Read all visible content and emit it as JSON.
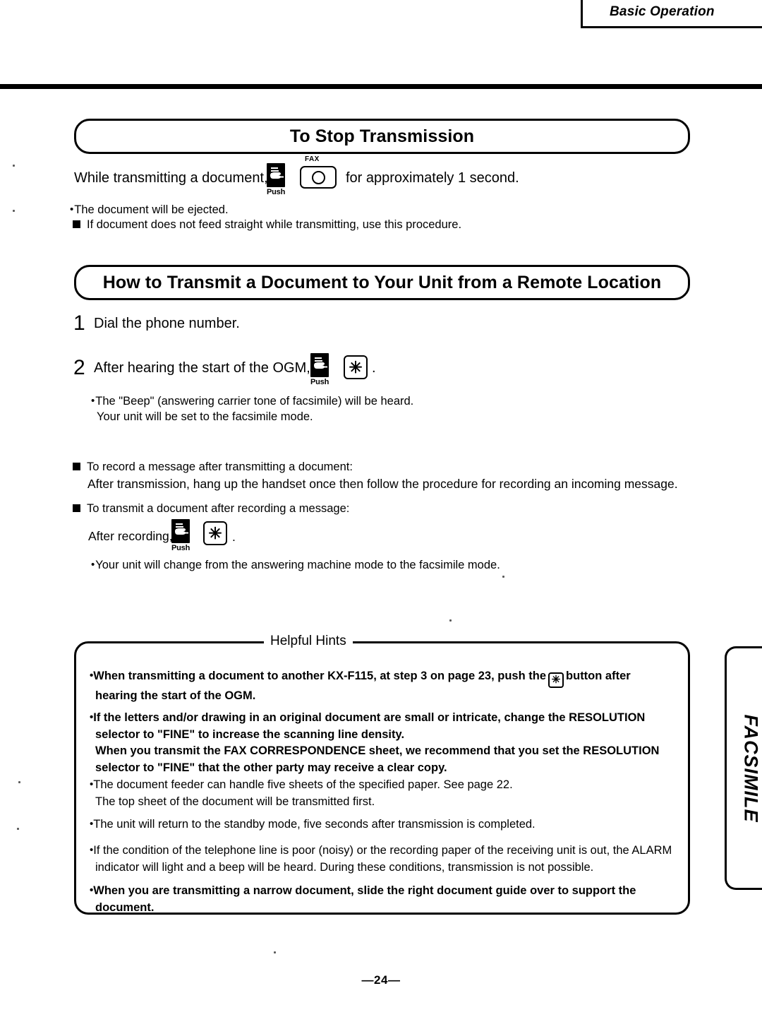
{
  "header": {
    "running_head": "Basic Operation"
  },
  "sections": [
    {
      "title": "To Stop Transmission",
      "instruction_before": "While transmitting a document,",
      "instruction_after": "for approximately 1 second.",
      "push_label": "Push",
      "fax_button_caption": "FAX",
      "notes": [
        "The document will be ejected."
      ],
      "square_notes": [
        "If document does not feed straight while transmitting, use this procedure."
      ]
    },
    {
      "title": "How to Transmit a Document to Your Unit from a Remote Location",
      "steps": [
        {
          "number": "1",
          "text": "Dial the phone number."
        },
        {
          "number": "2",
          "text_before": "After hearing the start of the OGM,",
          "text_after": ".",
          "push_label": "Push",
          "star_key": "✳",
          "notes": [
            "The \"Beep\" (answering carrier tone of facsimile) will be heard.",
            "Your unit will be set to the facsimile mode."
          ]
        }
      ],
      "square_notes": [
        {
          "heading": "To record a message after transmitting a document:",
          "body": "After transmission, hang up the handset once then follow the procedure for recording an incoming message."
        },
        {
          "heading": "To transmit a document after recording a message:",
          "action_before": "After recording,",
          "action_after": ".",
          "push_label": "Push",
          "star_key": "✳",
          "body_note": "Your unit will change from the answering machine mode to the facsimile mode."
        }
      ]
    }
  ],
  "helpful_hints": {
    "legend": "Helpful Hints",
    "items": [
      {
        "bold": true,
        "part1": "When transmitting a document to another KX-F115, at step 3 on page 23, push the",
        "star_key": "✳",
        "part2": "button after",
        "line2": "hearing the start of the OGM."
      },
      {
        "bold": true,
        "lines": [
          "If the letters and/or drawing in an original document are small or intricate, change the RESOLUTION",
          "selector to \"FINE\" to increase the scanning line density.",
          "When you transmit the FAX CORRESPONDENCE sheet, we recommend that you set the RESOLUTION",
          "selector to \"FINE\" that the other party may receive a clear copy."
        ]
      },
      {
        "bold": false,
        "lines": [
          "The document feeder can handle five sheets of the specified paper. See page 22.",
          "The top sheet of the document will be transmitted first."
        ]
      },
      {
        "bold": false,
        "lines": [
          "The unit will return to the standby mode, five seconds after transmission is completed."
        ]
      },
      {
        "bold": false,
        "lines": [
          "If the condition of the telephone line is poor (noisy) or the recording paper of the receiving unit is out, the ALARM",
          "indicator will light and a beep will be heard. During these conditions, transmission is not possible."
        ]
      },
      {
        "bold": true,
        "lines": [
          "When you are transmitting a narrow document, slide the right document guide over to support the",
          "document."
        ]
      }
    ]
  },
  "side_tab": {
    "label": "FACSIMILE"
  },
  "footer": {
    "page_number": "—24—"
  }
}
